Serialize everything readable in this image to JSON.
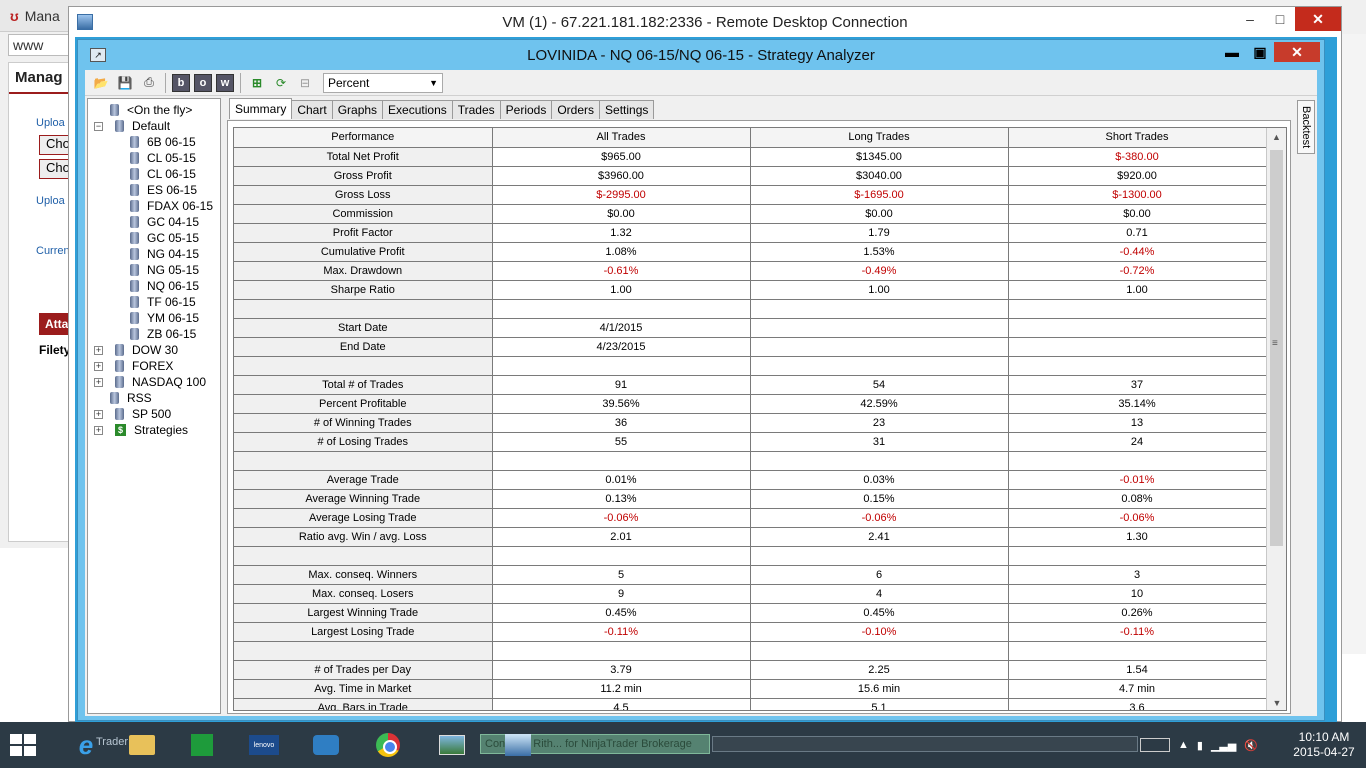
{
  "background_browser": {
    "tab_title": "Mana",
    "address": "www",
    "heading": "Manag",
    "labels": [
      "Uploa",
      "Uploa",
      "Curren"
    ],
    "buttons": [
      "Cho",
      "Cho"
    ],
    "attach_label": "Attac",
    "filetype_label": "Filety"
  },
  "rdp": {
    "title": "VM (1) - 67.221.181.182:2336 - Remote Desktop Connection",
    "minimize": "–",
    "maximize": "□",
    "close": "✕"
  },
  "app": {
    "title": "LOVINIDA - NQ 06-15/NQ 06-15 - Strategy Analyzer",
    "minimize": "▬",
    "maximize": "▣",
    "close": "✕"
  },
  "toolbar": {
    "display_select": "Percent",
    "buttons": [
      "b",
      "o",
      "w"
    ]
  },
  "tree": {
    "items": [
      {
        "label": "<On the fly>",
        "level": 1,
        "type": "db"
      },
      {
        "label": "Default",
        "level": 0,
        "type": "folder-open"
      },
      {
        "label": "6B 06-15",
        "level": 2,
        "type": "db"
      },
      {
        "label": "CL 05-15",
        "level": 2,
        "type": "db"
      },
      {
        "label": "CL 06-15",
        "level": 2,
        "type": "db"
      },
      {
        "label": "ES 06-15",
        "level": 2,
        "type": "db"
      },
      {
        "label": "FDAX 06-15",
        "level": 2,
        "type": "db"
      },
      {
        "label": "GC 04-15",
        "level": 2,
        "type": "db"
      },
      {
        "label": "GC 05-15",
        "level": 2,
        "type": "db"
      },
      {
        "label": "NG 04-15",
        "level": 2,
        "type": "db"
      },
      {
        "label": "NG 05-15",
        "level": 2,
        "type": "db"
      },
      {
        "label": "NQ 06-15",
        "level": 2,
        "type": "db"
      },
      {
        "label": "TF 06-15",
        "level": 2,
        "type": "db"
      },
      {
        "label": "YM 06-15",
        "level": 2,
        "type": "db"
      },
      {
        "label": "ZB 06-15",
        "level": 2,
        "type": "db"
      },
      {
        "label": "DOW 30",
        "level": 0,
        "type": "folder"
      },
      {
        "label": "FOREX",
        "level": 0,
        "type": "folder"
      },
      {
        "label": "NASDAQ 100",
        "level": 0,
        "type": "folder"
      },
      {
        "label": "RSS",
        "level": 1,
        "type": "db"
      },
      {
        "label": "SP 500",
        "level": 0,
        "type": "folder"
      },
      {
        "label": "Strategies",
        "level": 0,
        "type": "strategies"
      }
    ]
  },
  "tabs": [
    "Summary",
    "Chart",
    "Graphs",
    "Executions",
    "Trades",
    "Periods",
    "Orders",
    "Settings"
  ],
  "side_tab": "Backtest",
  "table": {
    "headers": [
      "Performance",
      "All Trades",
      "Long Trades",
      "Short Trades"
    ],
    "rows": [
      [
        "Total Net Profit",
        "$965.00",
        "$1345.00",
        "$-380.00"
      ],
      [
        "Gross Profit",
        "$3960.00",
        "$3040.00",
        "$920.00"
      ],
      [
        "Gross Loss",
        "$-2995.00",
        "$-1695.00",
        "$-1300.00"
      ],
      [
        "Commission",
        "$0.00",
        "$0.00",
        "$0.00"
      ],
      [
        "Profit Factor",
        "1.32",
        "1.79",
        "0.71"
      ],
      [
        "Cumulative Profit",
        "1.08%",
        "1.53%",
        "-0.44%"
      ],
      [
        "Max. Drawdown",
        "-0.61%",
        "-0.49%",
        "-0.72%"
      ],
      [
        "Sharpe Ratio",
        "1.00",
        "1.00",
        "1.00"
      ],
      [
        "",
        "",
        "",
        ""
      ],
      [
        "Start Date",
        "4/1/2015",
        "",
        ""
      ],
      [
        "End Date",
        "4/23/2015",
        "",
        ""
      ],
      [
        "",
        "",
        "",
        ""
      ],
      [
        "Total # of Trades",
        "91",
        "54",
        "37"
      ],
      [
        "Percent Profitable",
        "39.56%",
        "42.59%",
        "35.14%"
      ],
      [
        "# of Winning Trades",
        "36",
        "23",
        "13"
      ],
      [
        "# of Losing Trades",
        "55",
        "31",
        "24"
      ],
      [
        "",
        "",
        "",
        ""
      ],
      [
        "Average Trade",
        "0.01%",
        "0.03%",
        "-0.01%"
      ],
      [
        "Average Winning Trade",
        "0.13%",
        "0.15%",
        "0.08%"
      ],
      [
        "Average Losing Trade",
        "-0.06%",
        "-0.06%",
        "-0.06%"
      ],
      [
        "Ratio avg. Win / avg. Loss",
        "2.01",
        "2.41",
        "1.30"
      ],
      [
        "",
        "",
        "",
        ""
      ],
      [
        "Max. conseq. Winners",
        "5",
        "6",
        "3"
      ],
      [
        "Max. conseq. Losers",
        "9",
        "4",
        "10"
      ],
      [
        "Largest Winning Trade",
        "0.45%",
        "0.45%",
        "0.26%"
      ],
      [
        "Largest Losing Trade",
        "-0.11%",
        "-0.10%",
        "-0.11%"
      ],
      [
        "",
        "",
        "",
        ""
      ],
      [
        "# of Trades per Day",
        "3.79",
        "2.25",
        "1.54"
      ],
      [
        "Avg. Time in Market",
        "11.2 min",
        "15.6 min",
        "4.7 min"
      ],
      [
        "Avg. Bars in Trade",
        "4.5",
        "5.1",
        "3.6"
      ]
    ]
  },
  "taskbar": {
    "trader_label": "Trader",
    "active_window": "Con... d - Rith... for NinjaTrader Brokerage",
    "time": "10:10 AM",
    "date": "2015-04-27"
  },
  "colors": {
    "negative": "#c00000",
    "app_title_bar": "#6fc3ee",
    "taskbar": "#2c3a45"
  }
}
